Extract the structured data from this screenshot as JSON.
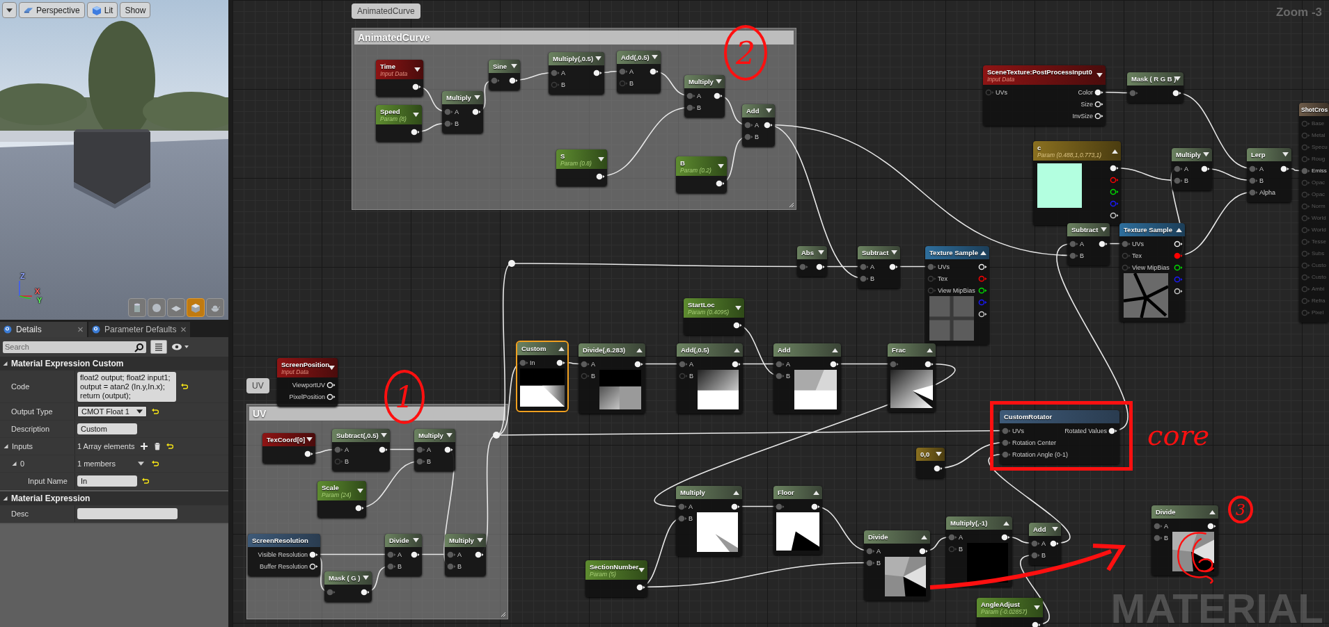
{
  "viewport": {
    "view_mode": "Perspective",
    "lighting": "Lit",
    "show": "Show",
    "axes": [
      "Z",
      "X",
      "Y"
    ],
    "preview_shapes": [
      {
        "selected": false
      },
      {
        "selected": false
      },
      {
        "selected": false
      },
      {
        "selected": true
      },
      {
        "selected": false
      }
    ]
  },
  "details": {
    "tabs": [
      {
        "label": "Details",
        "selected": true
      },
      {
        "label": "Parameter Defaults",
        "selected": false
      }
    ],
    "search": {
      "placeholder": "Search"
    },
    "sections": [
      {
        "title": "Material Expression Custom",
        "expanded": true,
        "rows": [
          {
            "kind": "textarea",
            "label": "Code",
            "value": "float2 output; float2 input1; output = atan2 (In.y,In.x); return (output);",
            "resettable": true
          },
          {
            "kind": "dropdown",
            "label": "Output Type",
            "value": "CMOT Float 1",
            "resettable": true
          },
          {
            "kind": "text",
            "label": "Description",
            "value": "Custom",
            "resettable": false
          },
          {
            "kind": "array",
            "label": "Inputs",
            "value": "1 Array elements",
            "expanded": true,
            "resettable": true,
            "children": [
              {
                "kind": "element",
                "label": "0",
                "value": "1 members",
                "expanded": true,
                "resettable": true,
                "children": [
                  {
                    "kind": "text",
                    "label": "Input Name",
                    "value": "In",
                    "resettable": true
                  }
                ]
              }
            ]
          }
        ]
      },
      {
        "title": "Material Expression",
        "expanded": true,
        "rows": [
          {
            "kind": "text",
            "label": "Desc",
            "resettable": false
          }
        ]
      }
    ]
  },
  "graph": {
    "zoom_label": "Zoom -3",
    "watermark": "MATERIAL",
    "comments": [
      {
        "bubble": "AnimatedCurve",
        "title": "AnimatedCurve"
      },
      {
        "bubble": "UV",
        "title": "UV"
      }
    ],
    "nodes": [
      {
        "kind": "input",
        "title": "Time",
        "subtitle": "Input Data",
        "expanded": false,
        "selected": false,
        "outputs": [
          {
            "connected": true
          }
        ]
      },
      {
        "kind": "param",
        "title": "Speed",
        "subtitle": "Param (8)",
        "expanded": false,
        "selected": false,
        "outputs": [
          {
            "connected": true
          }
        ]
      },
      {
        "kind": "op",
        "title": "Multiply",
        "expanded": false,
        "selected": false,
        "inputs": [
          {
            "label": "A",
            "connected": true
          },
          {
            "label": "B",
            "connected": true
          }
        ],
        "outputs": [
          {
            "connected": true
          }
        ]
      },
      {
        "kind": "op",
        "title": "Sine",
        "expanded": false,
        "selected": false,
        "inputs": [
          {
            "connected": true
          }
        ],
        "outputs": [
          {
            "connected": true
          }
        ]
      },
      {
        "kind": "op",
        "title": "Multiply(,0.5)",
        "expanded": false,
        "selected": false,
        "inputs": [
          {
            "label": "A",
            "connected": true
          },
          {
            "label": "B",
            "connected": false
          }
        ],
        "outputs": [
          {
            "connected": true
          }
        ]
      },
      {
        "kind": "op",
        "title": "Add(,0.5)",
        "expanded": false,
        "selected": false,
        "inputs": [
          {
            "label": "A",
            "connected": true
          },
          {
            "label": "B",
            "connected": false
          }
        ],
        "outputs": [
          {
            "connected": true
          }
        ]
      },
      {
        "kind": "op",
        "title": "Multiply",
        "expanded": false,
        "selected": false,
        "inputs": [
          {
            "label": "A",
            "connected": true
          },
          {
            "label": "B",
            "connected": true
          }
        ],
        "outputs": [
          {
            "connected": true
          }
        ]
      },
      {
        "kind": "op",
        "title": "Add",
        "expanded": false,
        "selected": false,
        "inputs": [
          {
            "label": "A",
            "connected": true
          },
          {
            "label": "B",
            "connected": true
          }
        ],
        "outputs": [
          {
            "connected": true
          }
        ]
      },
      {
        "kind": "param",
        "title": "S",
        "subtitle": "Param (0.8)",
        "expanded": false,
        "selected": false,
        "outputs": [
          {
            "connected": true
          }
        ]
      },
      {
        "kind": "param",
        "title": "B",
        "subtitle": "Param (0.2)",
        "expanded": false,
        "selected": false,
        "outputs": [
          {
            "connected": true
          }
        ]
      },
      {
        "kind": "input",
        "title": "SceneTexture:PostProcessInput0",
        "subtitle": "Input Data",
        "expanded": false,
        "selected": false,
        "inputs": [
          {
            "label": "UVs",
            "connected": false
          }
        ],
        "outputs": [
          {
            "label": "Color",
            "connected": true
          },
          {
            "label": "Size",
            "connected": false
          },
          {
            "label": "InvSize",
            "connected": false
          }
        ]
      },
      {
        "kind": "op",
        "title": "Mask ( R G B )",
        "expanded": false,
        "selected": false,
        "inputs": [
          {
            "connected": true
          }
        ],
        "outputs": [
          {
            "connected": true
          }
        ]
      },
      {
        "kind": "vector",
        "title": "c",
        "subtitle": "Param (0.488,1,0.773,1)",
        "expanded": true,
        "selected": false,
        "color": "#b3ffe0",
        "outputs": [
          {
            "connected": true
          },
          {
            "connected": false,
            "color": "#ff0000"
          },
          {
            "connected": false,
            "color": "#00dd00"
          },
          {
            "connected": false,
            "color": "#1a1aff"
          },
          {
            "connected": false,
            "color": "#cccccc"
          }
        ]
      },
      {
        "kind": "op",
        "title": "Multiply",
        "expanded": false,
        "selected": false,
        "inputs": [
          {
            "label": "A",
            "connected": true
          },
          {
            "label": "B",
            "connected": true
          }
        ],
        "outputs": [
          {
            "connected": true
          }
        ]
      },
      {
        "kind": "op",
        "title": "Lerp",
        "expanded": false,
        "selected": false,
        "inputs": [
          {
            "label": "A",
            "connected": true
          },
          {
            "label": "B",
            "connected": true
          },
          {
            "label": "Alpha",
            "connected": true
          }
        ],
        "outputs": [
          {
            "connected": true
          }
        ]
      },
      {
        "kind": "output",
        "title": "ShotCros",
        "selected": false,
        "inputs": [
          {
            "label": "Base",
            "connected": false
          },
          {
            "label": "Metal",
            "connected": false
          },
          {
            "label": "Specu",
            "connected": false
          },
          {
            "label": "Roug",
            "connected": false
          },
          {
            "label": "Emiss",
            "connected": true
          },
          {
            "label": "Opac",
            "connected": false
          },
          {
            "label": "Opac",
            "connected": false
          },
          {
            "label": "Norm",
            "connected": false
          },
          {
            "label": "World",
            "connected": false
          },
          {
            "label": "World",
            "connected": false
          },
          {
            "label": "Tesse",
            "connected": false
          },
          {
            "label": "Subs",
            "connected": false
          },
          {
            "label": "Custo",
            "connected": false
          },
          {
            "label": "Custo",
            "connected": false
          },
          {
            "label": "Ambi",
            "connected": false
          },
          {
            "label": "Refra",
            "connected": false
          },
          {
            "label": "Pixel",
            "connected": false
          }
        ]
      },
      {
        "kind": "op",
        "title": "Subtract",
        "expanded": false,
        "selected": false,
        "inputs": [
          {
            "label": "A",
            "connected": true
          },
          {
            "label": "B",
            "connected": true
          }
        ],
        "outputs": [
          {
            "connected": true
          }
        ]
      },
      {
        "kind": "texture",
        "title": "Texture Sample",
        "expanded": true,
        "selected": false,
        "inputs": [
          {
            "label": "UVs",
            "connected": true
          },
          {
            "label": "Tex",
            "connected": false
          },
          {
            "label": "View MipBias",
            "connected": false
          }
        ],
        "outputs": [
          {
            "connected": false
          },
          {
            "connected": true,
            "color": "#ff0000"
          },
          {
            "connected": false,
            "color": "#00dd00"
          },
          {
            "connected": false,
            "color": "#1a1aff"
          },
          {
            "connected": false,
            "color": "#cccccc"
          }
        ]
      },
      {
        "kind": "op",
        "title": "Abs",
        "expanded": false,
        "selected": false,
        "inputs": [
          {
            "connected": true
          }
        ],
        "outputs": [
          {
            "connected": true
          }
        ]
      },
      {
        "kind": "op",
        "title": "Subtract",
        "expanded": false,
        "selected": false,
        "inputs": [
          {
            "label": "A",
            "connected": true
          },
          {
            "label": "B",
            "connected": true
          }
        ],
        "outputs": [
          {
            "connected": true
          }
        ]
      },
      {
        "kind": "texture",
        "title": "Texture Sample",
        "expanded": true,
        "selected": false,
        "inputs": [
          {
            "label": "UVs",
            "connected": true
          },
          {
            "label": "Tex",
            "connected": false
          },
          {
            "label": "View MipBias",
            "connected": false
          }
        ],
        "outputs": [
          {
            "connected": false
          },
          {
            "connected": false,
            "color": "#ff0000"
          },
          {
            "connected": false,
            "color": "#00dd00"
          },
          {
            "connected": false,
            "color": "#1a1aff"
          },
          {
            "connected": false,
            "color": "#cccccc"
          }
        ]
      },
      {
        "kind": "param",
        "title": "StartLoc",
        "subtitle": "Param (0.4095)",
        "expanded": false,
        "selected": false,
        "outputs": [
          {
            "connected": true
          }
        ]
      },
      {
        "kind": "op",
        "title": "Custom",
        "expanded": true,
        "selected": true,
        "inputs": [
          {
            "label": "In",
            "connected": true
          }
        ],
        "outputs": [
          {
            "connected": true
          }
        ]
      },
      {
        "kind": "op",
        "title": "Divide(,6.283)",
        "expanded": true,
        "selected": false,
        "inputs": [
          {
            "label": "A",
            "connected": true
          },
          {
            "label": "B",
            "connected": false
          }
        ],
        "outputs": [
          {
            "connected": true
          }
        ]
      },
      {
        "kind": "op",
        "title": "Add(,0.5)",
        "expanded": true,
        "selected": false,
        "inputs": [
          {
            "label": "A",
            "connected": true
          },
          {
            "label": "B",
            "connected": false
          }
        ],
        "outputs": [
          {
            "connected": true
          }
        ]
      },
      {
        "kind": "op",
        "title": "Add",
        "expanded": true,
        "selected": false,
        "inputs": [
          {
            "label": "A",
            "connected": true
          },
          {
            "label": "B",
            "connected": true
          }
        ],
        "outputs": [
          {
            "connected": true
          }
        ]
      },
      {
        "kind": "op",
        "title": "Frac",
        "expanded": true,
        "selected": false,
        "inputs": [
          {
            "connected": true
          }
        ],
        "outputs": [
          {
            "connected": true
          }
        ]
      },
      {
        "kind": "input",
        "title": "ScreenPosition",
        "subtitle": "Input Data",
        "expanded": false,
        "selected": false,
        "outputs": [
          {
            "label": "ViewportUV",
            "connected": false
          },
          {
            "label": "PixelPosition",
            "connected": false
          }
        ]
      },
      {
        "kind": "input",
        "title": "TexCoord[0]",
        "expanded": false,
        "selected": false,
        "outputs": [
          {
            "connected": true
          }
        ]
      },
      {
        "kind": "op",
        "title": "Subtract(,0.5)",
        "expanded": false,
        "selected": false,
        "inputs": [
          {
            "label": "A",
            "connected": true
          },
          {
            "label": "B",
            "connected": false
          }
        ],
        "outputs": [
          {
            "connected": true
          }
        ]
      },
      {
        "kind": "op",
        "title": "Multiply",
        "expanded": false,
        "selected": false,
        "inputs": [
          {
            "label": "A",
            "connected": true
          },
          {
            "label": "B",
            "connected": true
          }
        ],
        "outputs": [
          {
            "connected": true
          }
        ]
      },
      {
        "kind": "param",
        "title": "Scale",
        "subtitle": "Param (24)",
        "expanded": false,
        "selected": false,
        "outputs": [
          {
            "connected": true
          }
        ]
      },
      {
        "kind": "function",
        "title": "ScreenResolution",
        "selected": false,
        "outputs": [
          {
            "label": "Visible Resolution",
            "connected": true
          },
          {
            "label": "Buffer Resolution",
            "connected": false
          }
        ]
      },
      {
        "kind": "op",
        "title": "Divide",
        "expanded": false,
        "selected": false,
        "inputs": [
          {
            "label": "A",
            "connected": true
          },
          {
            "label": "B",
            "connected": true
          }
        ],
        "outputs": [
          {
            "connected": true
          }
        ]
      },
      {
        "kind": "op",
        "title": "Multiply",
        "expanded": false,
        "selected": false,
        "inputs": [
          {
            "label": "A",
            "connected": true
          },
          {
            "label": "B",
            "connected": true
          }
        ],
        "outputs": [
          {
            "connected": true
          }
        ]
      },
      {
        "kind": "op",
        "title": "Mask ( G )",
        "expanded": false,
        "selected": false,
        "inputs": [
          {
            "connected": true
          }
        ],
        "outputs": [
          {
            "connected": true
          }
        ]
      },
      {
        "kind": "param",
        "title": "SectionNumber",
        "subtitle": "Param (5)",
        "expanded": false,
        "selected": false,
        "outputs": [
          {
            "connected": true
          }
        ]
      },
      {
        "kind": "vector",
        "title": "0,0",
        "expanded": false,
        "selected": false,
        "outputs": [
          {
            "connected": true
          }
        ]
      },
      {
        "kind": "function",
        "title": "CustomRotator",
        "selected": false,
        "inputs": [
          {
            "label": "UVs",
            "connected": true
          },
          {
            "label": "Rotation Center",
            "connected": true
          },
          {
            "label": "Rotation Angle (0-1)",
            "connected": true
          }
        ],
        "outputs": [
          {
            "label": "Rotated Values",
            "connected": true
          }
        ]
      },
      {
        "kind": "op",
        "title": "Multiply",
        "expanded": true,
        "selected": false,
        "inputs": [
          {
            "label": "A",
            "connected": true
          },
          {
            "label": "B",
            "connected": true
          }
        ],
        "outputs": [
          {
            "connected": true
          }
        ]
      },
      {
        "kind": "op",
        "title": "Floor",
        "expanded": true,
        "selected": false,
        "inputs": [
          {
            "connected": true
          }
        ],
        "outputs": [
          {
            "connected": true
          }
        ]
      },
      {
        "kind": "op",
        "title": "Divide",
        "expanded": true,
        "selected": false,
        "inputs": [
          {
            "label": "A",
            "connected": true
          },
          {
            "label": "B",
            "connected": true
          }
        ],
        "outputs": [
          {
            "connected": true
          }
        ]
      },
      {
        "kind": "op",
        "title": "Multiply(,-1)",
        "expanded": true,
        "selected": false,
        "inputs": [
          {
            "label": "A",
            "connected": true
          },
          {
            "label": "B",
            "connected": false
          }
        ],
        "outputs": [
          {
            "connected": true
          }
        ]
      },
      {
        "kind": "op",
        "title": "Add",
        "expanded": false,
        "selected": false,
        "inputs": [
          {
            "label": "A",
            "connected": true
          },
          {
            "label": "B",
            "connected": true
          }
        ],
        "outputs": [
          {
            "connected": true
          }
        ]
      },
      {
        "kind": "param",
        "title": "AngleAdjust",
        "subtitle": "Param (-0.02857)",
        "expanded": false,
        "selected": false,
        "outputs": [
          {
            "connected": true
          }
        ]
      },
      {
        "kind": "op",
        "title": "Divide",
        "expanded": true,
        "selected": false,
        "inputs": [
          {
            "label": "A",
            "connected": true
          },
          {
            "label": "B",
            "connected": true
          }
        ],
        "outputs": [
          {
            "connected": true
          }
        ]
      },
      {
        "kind": "reroute"
      },
      {
        "kind": "reroute"
      }
    ],
    "annotations": [
      {
        "kind": "circled",
        "text": "2"
      },
      {
        "kind": "circled",
        "text": "1"
      },
      {
        "kind": "frame"
      },
      {
        "kind": "note",
        "text": "core"
      },
      {
        "kind": "circled",
        "text": "3"
      },
      {
        "kind": "scribble"
      },
      {
        "kind": "arrow"
      }
    ]
  }
}
